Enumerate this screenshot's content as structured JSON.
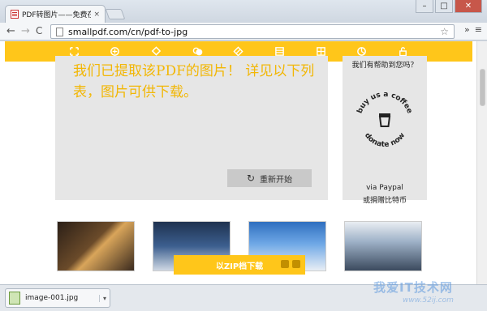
{
  "browser": {
    "tab_title": "PDF转图片——免费在线P",
    "tab_close": "×",
    "url": "smallpdf.com/cn/pdf-to-jpg",
    "window_buttons": {
      "minimize": "–",
      "maximize": "□",
      "close": "✕"
    },
    "nav": {
      "back": "←",
      "forward": "→",
      "reload": "C"
    },
    "toolbar_extra": {
      "more": "»",
      "menu": "≡"
    }
  },
  "tools": [
    "compress",
    "convert",
    "merge",
    "split",
    "edit",
    "grid",
    "pie",
    "unlock"
  ],
  "result": {
    "message": "我们已提取该PDF的图片！ 详见以下列表，图片可供下载。",
    "restart_label": "重新开始"
  },
  "coffee": {
    "header": "我们有帮助到您吗？",
    "ring_top": "buy us a coffee",
    "ring_bottom": "donate now",
    "via": "via Paypal",
    "alt": "或捐赠比特币"
  },
  "zip_button": "以ZIP档下载",
  "download": {
    "filename": "image-001.jpg",
    "menu": "▾"
  },
  "watermark": {
    "text": "我爱IT技术网",
    "url": "www.52ij.com"
  },
  "colors": {
    "brand": "#ffc61a",
    "message": "#f2b705",
    "panel": "#e6e6e6"
  }
}
